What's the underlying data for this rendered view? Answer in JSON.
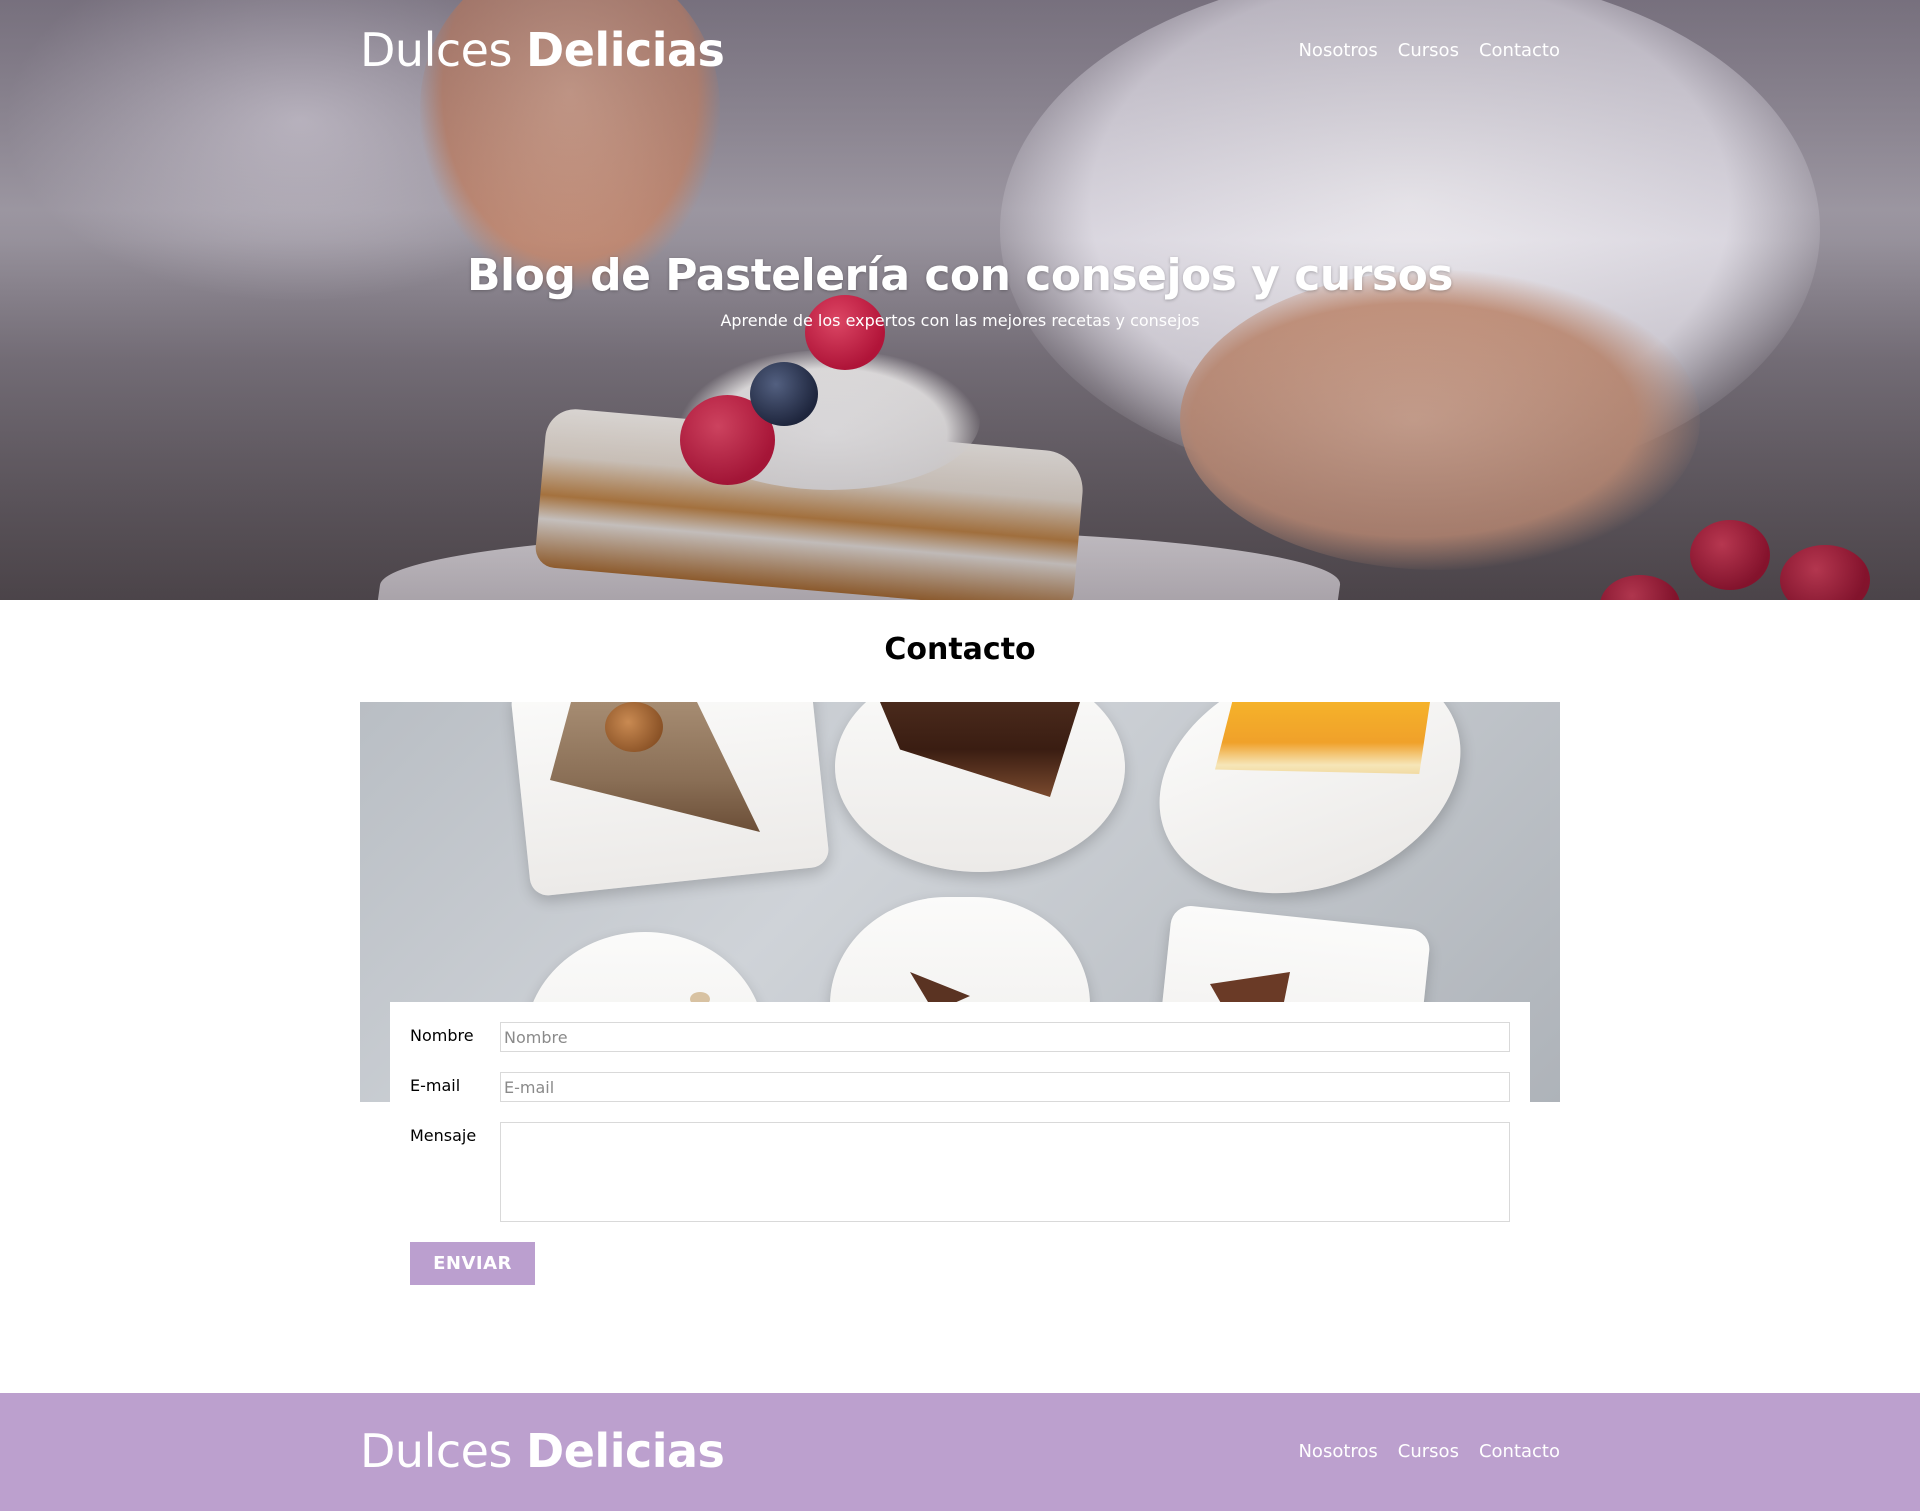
{
  "header": {
    "logo_light": "Dulces",
    "logo_bold": "Delicias",
    "nav": [
      {
        "label": "Nosotros"
      },
      {
        "label": "Cursos"
      },
      {
        "label": "Contacto"
      }
    ]
  },
  "hero": {
    "title": "Blog de Pastelería con consejos y cursos",
    "subtitle": "Aprende de los expertos con las mejores recetas y consejos"
  },
  "contact": {
    "title": "Contacto",
    "form": {
      "name_label": "Nombre",
      "name_placeholder": "Nombre",
      "name_value": "",
      "email_label": "E-mail",
      "email_placeholder": "E-mail",
      "email_value": "",
      "message_label": "Mensaje",
      "message_value": "",
      "submit_label": "ENVIAR"
    }
  },
  "footer": {
    "logo_light": "Dulces",
    "logo_bold": "Delicias",
    "nav": [
      {
        "label": "Nosotros"
      },
      {
        "label": "Cursos"
      },
      {
        "label": "Contacto"
      }
    ]
  },
  "colors": {
    "accent": "#bb9fcf",
    "footer_bg": "#bca0ce",
    "text": "#000000",
    "hero_text": "#ffffff"
  }
}
